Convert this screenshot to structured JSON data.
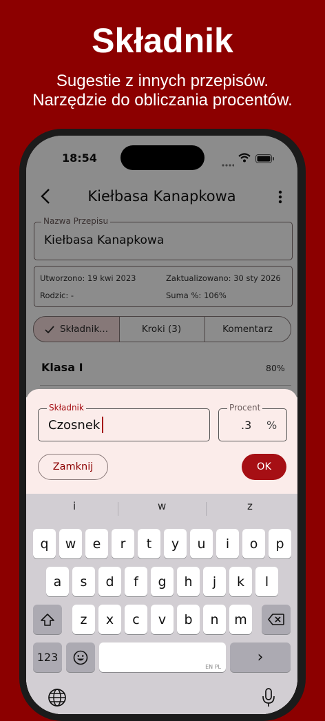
{
  "promo": {
    "title": "Składnik",
    "subtitle_line1": "Sugestie z innych przepisów.",
    "subtitle_line2": "Narzędzie do obliczania procentów."
  },
  "status_bar": {
    "time": "18:54"
  },
  "nav": {
    "title": "Kiełbasa Kanapkowa"
  },
  "recipe_name": {
    "label": "Nazwa Przepisu",
    "value": "Kiełbasa Kanapkowa"
  },
  "info": {
    "created": "Utworzono: 19 kwi 2023",
    "updated": "Zaktualizowano: 30 sty 2026",
    "parent": "Rodzic: -",
    "sum": "Suma %: 106%"
  },
  "tabs": [
    {
      "label": "Składnik...",
      "selected": true
    },
    {
      "label": "Kroki (3)",
      "selected": false
    },
    {
      "label": "Komentarz",
      "selected": false
    }
  ],
  "section": {
    "name": "Klasa I",
    "percent": "80%"
  },
  "dialog": {
    "ingredient_label": "Składnik",
    "ingredient_value": "Czosnek",
    "percent_label": "Procent",
    "percent_value": ".3",
    "percent_unit": "%",
    "close_label": "Zamknij",
    "ok_label": "OK"
  },
  "keyboard": {
    "suggestions": [
      "i",
      "w",
      "z"
    ],
    "row1": [
      "q",
      "w",
      "e",
      "r",
      "t",
      "y",
      "u",
      "i",
      "o",
      "p"
    ],
    "row2": [
      "a",
      "s",
      "d",
      "f",
      "g",
      "h",
      "j",
      "k",
      "l"
    ],
    "row3": [
      "z",
      "x",
      "c",
      "v",
      "b",
      "n",
      "m"
    ],
    "numbers_label": "123",
    "space_lang": "EN PL",
    "return_label": "›"
  },
  "colors": {
    "brand": "#8c0000",
    "accent": "#a60f14",
    "sheet": "#fbecea"
  }
}
